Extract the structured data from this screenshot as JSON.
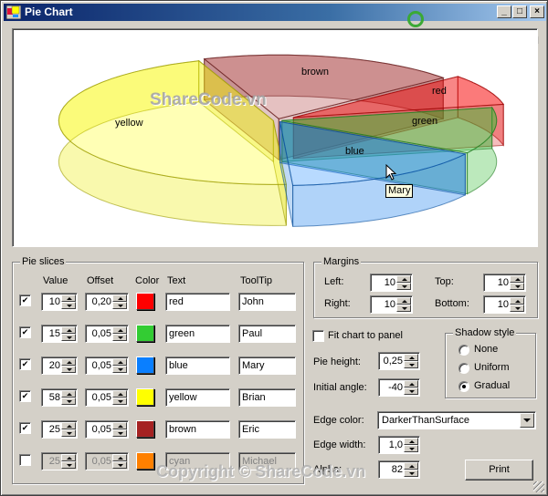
{
  "window": {
    "title": "Pie Chart",
    "minimize_label": "_",
    "maximize_label": "□",
    "close_label": "×",
    "watermark_brand": "SHARE",
    "watermark_brand_code": "CODE.vn"
  },
  "chart": {
    "watermark_center": "ShareCode.vn",
    "tooltip": "Mary"
  },
  "chart_data": {
    "type": "pie",
    "style": "3d-exploded",
    "title": "",
    "slices": [
      {
        "label": "red",
        "value": 10,
        "offset": 0.2,
        "color": "#ff0000",
        "tooltip": "John",
        "visible": true
      },
      {
        "label": "green",
        "value": 15,
        "offset": 0.05,
        "color": "#33cc33",
        "tooltip": "Paul",
        "visible": true
      },
      {
        "label": "blue",
        "value": 20,
        "offset": 0.05,
        "color": "#0a7fff",
        "tooltip": "Mary",
        "visible": true
      },
      {
        "label": "yellow",
        "value": 58,
        "offset": 0.05,
        "color": "#ffff00",
        "tooltip": "Brian",
        "visible": true
      },
      {
        "label": "brown",
        "value": 25,
        "offset": 0.05,
        "color": "#a52a2a",
        "tooltip": "Eric",
        "visible": true
      }
    ],
    "pie_height": 0.25,
    "initial_angle": -40,
    "alpha": 82
  },
  "pie_slices": {
    "legend": "Pie slices",
    "headers": {
      "value": "Value",
      "offset": "Offset",
      "color": "Color",
      "text": "Text",
      "tooltip": "ToolTip"
    },
    "rows": [
      {
        "checked": true,
        "value": "10",
        "offset": "0,20",
        "color": "#ff0000",
        "text": "red",
        "tooltip": "John"
      },
      {
        "checked": true,
        "value": "15",
        "offset": "0,05",
        "color": "#33cc33",
        "text": "green",
        "tooltip": "Paul"
      },
      {
        "checked": true,
        "value": "20",
        "offset": "0,05",
        "color": "#0a7fff",
        "text": "blue",
        "tooltip": "Mary"
      },
      {
        "checked": true,
        "value": "58",
        "offset": "0,05",
        "color": "#ffff00",
        "text": "yellow",
        "tooltip": "Brian"
      },
      {
        "checked": true,
        "value": "25",
        "offset": "0,05",
        "color": "#a52222",
        "text": "brown",
        "tooltip": "Eric"
      },
      {
        "checked": false,
        "value": "25",
        "offset": "0,05",
        "color": "#ff8000",
        "text": "cyan",
        "tooltip": "Michael"
      }
    ]
  },
  "margins": {
    "legend": "Margins",
    "left_label": "Left:",
    "left": "10",
    "right_label": "Right:",
    "right": "10",
    "top_label": "Top:",
    "top": "10",
    "bottom_label": "Bottom:",
    "bottom": "10"
  },
  "options": {
    "fit_label": "Fit chart to panel",
    "fit_checked": false,
    "pie_height_label": "Pie height:",
    "pie_height": "0,25",
    "initial_angle_label": "Initial angle:",
    "initial_angle": "-40",
    "edge_color_label": "Edge color:",
    "edge_color": "DarkerThanSurface",
    "edge_width_label": "Edge width:",
    "edge_width": "1,0",
    "alpha_label": "Alpha:",
    "alpha": "82",
    "print_label": "Print"
  },
  "shadow_style": {
    "legend": "Shadow style",
    "options": [
      {
        "label": "None",
        "selected": false
      },
      {
        "label": "Uniform",
        "selected": false
      },
      {
        "label": "Gradual",
        "selected": true
      }
    ]
  },
  "footer": {
    "copyright_watermark": "Copyright © ShareCode.vn"
  }
}
